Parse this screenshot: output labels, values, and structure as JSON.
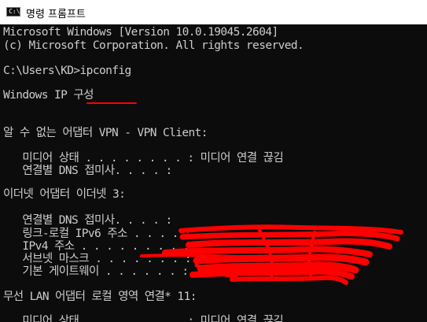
{
  "window": {
    "title": "명령 프롬프트",
    "icon": "cmd-icon"
  },
  "console": {
    "lines": [
      "Microsoft Windows [Version 10.0.19045.2604]",
      "(c) Microsoft Corporation. All rights reserved.",
      "",
      "C:\\Users\\KD>ipconfig",
      "",
      "Windows IP 구성",
      "",
      "",
      "알 수 없는 어댑터 VPN - VPN Client:",
      "",
      "   미디어 상태 . . . . . . . . : 미디어 연결 끊김",
      "   연결별 DNS 접미사. . . . :",
      "",
      "이더넷 어댑터 이더넷 3:",
      "",
      "   연결별 DNS 접미사. . . . :",
      "   링크-로컬 IPv6 주소 . . . . :",
      "   IPv4 주소 . . . . . . . . . :",
      "   서브넷 마스크 . . . . . . . :",
      "   기본 게이트웨이 . . . . . . :",
      "",
      "무선 LAN 어댑터 로컬 영역 연결* 11:",
      "",
      "   미디어 상태 . . . . . . . . : 미디어 연결 끊김"
    ]
  },
  "colors": {
    "console_bg": "#0c0c0c",
    "console_fg": "#cccccc",
    "redaction": "#ff0000"
  }
}
